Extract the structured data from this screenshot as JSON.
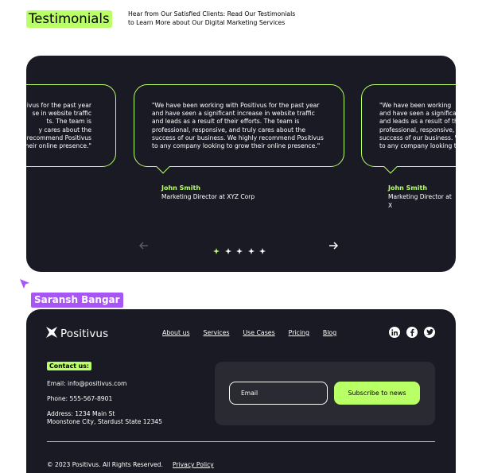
{
  "header": {
    "title": "Testimonials",
    "description": "Hear from Our Satisfied Clients: Read Our Testimonials\nto Learn More about Our Digital Marketing Services"
  },
  "testimonials": {
    "left": {
      "quote": "ivus for the past year\nse in website traffic\nts. The team is\ny cares about the\ny recommend Positivus\nheir online presence.\""
    },
    "center": {
      "quote": "\"We have been working with Positivus for the past year\nand have seen a significant increase in website traffic\nand leads as a result of their efforts. The team is\nprofessional, responsive, and truly cares about the\nsuccess of our business. We highly recommend Positivus\nto any company looking to grow their online presence.\"",
      "name": "John Smith",
      "role": "Marketing Director at XYZ Corp"
    },
    "right": {
      "quote": "\"We have been working\nand leads as a result of\nprofessional, responsive, a\nsuccess of our business. W\nto any company looking t",
      "quote_full": "\"We have been working\nand have seen a significan\nand leads as a result of th\nprofessional, responsive, a\nsuccess of our business. W\nto any company looking t",
      "name": "John Smith",
      "role": "Marketing Director at X"
    },
    "pagination": {
      "count": 5,
      "active_index": 0
    },
    "prev_icon": "arrow-left-icon",
    "next_icon": "arrow-right-icon"
  },
  "cursor": {
    "name": "Saransh Bangar",
    "color": "#a855f7"
  },
  "footer": {
    "logo": "Positivus",
    "nav": [
      "About us",
      "Services",
      "Use Cases",
      "Pricing",
      "Blog"
    ],
    "socials": [
      "linkedin-icon",
      "facebook-icon",
      "twitter-icon"
    ],
    "contact_label": "Contact us:",
    "email": "Email: info@positivus.com",
    "phone": "Phone: 555-567-8901",
    "address": "Address: 1234 Main St\nMoonstone City, Stardust State 12345",
    "email_placeholder": "Email",
    "subscribe_label": "Subscribe to news",
    "copyright": "© 2023 Positivus. All Rights Reserved.",
    "privacy": "Privacy Policy"
  },
  "colors": {
    "accent": "#b9ff66",
    "dark": "#191a23",
    "panel": "#292a32"
  }
}
